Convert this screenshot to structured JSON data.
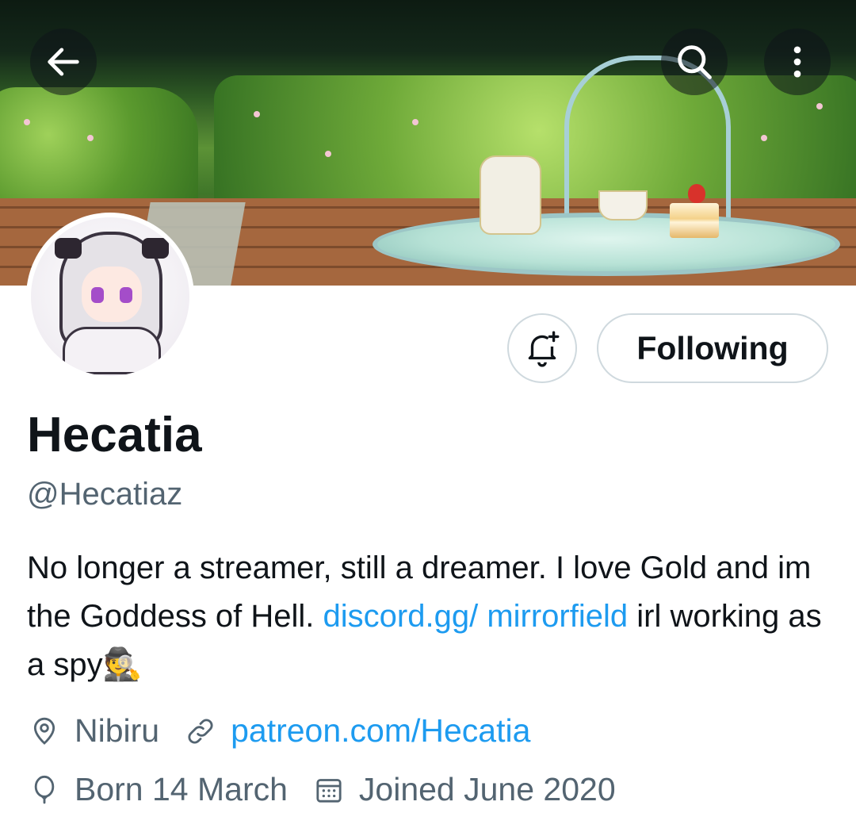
{
  "header": {
    "back_icon": "arrow-left-icon",
    "search_icon": "search-icon",
    "more_icon": "more-vertical-icon"
  },
  "profile": {
    "display_name": "Hecatia",
    "handle": "@Hecatiaz",
    "follow_button_label": "Following",
    "notify_icon": "bell-plus-icon"
  },
  "bio": {
    "text_1": "No longer a streamer, still a dreamer. I love Gold and im the Goddess of Hell. ",
    "link_1": "discord.gg/ mirrorfield",
    "text_2": " irl working as a spy",
    "emoji": "🕵"
  },
  "meta": {
    "location": "Nibiru",
    "website": "patreon.com/Hecatia",
    "birthday": "Born 14 March",
    "joined": "Joined June 2020"
  },
  "colors": {
    "link": "#1d9bf0",
    "secondary_text": "#536471",
    "primary_text": "#0f1419",
    "border": "#cfd9de"
  }
}
